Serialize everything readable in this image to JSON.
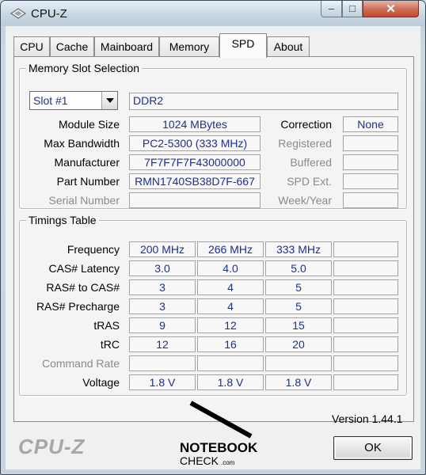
{
  "window": {
    "title": "CPU-Z"
  },
  "tabs": [
    "CPU",
    "Cache",
    "Mainboard",
    "Memory",
    "SPD",
    "About"
  ],
  "active_tab": "SPD",
  "slot_group": {
    "title": "Memory Slot Selection",
    "slot_selected": "Slot #1",
    "memory_type": "DDR2",
    "labels": {
      "module_size": "Module Size",
      "max_bandwidth": "Max Bandwidth",
      "manufacturer": "Manufacturer",
      "part_number": "Part Number",
      "serial_number": "Serial Number",
      "correction": "Correction",
      "registered": "Registered",
      "buffered": "Buffered",
      "spd_ext": "SPD Ext.",
      "week_year": "Week/Year"
    },
    "values": {
      "module_size": "1024 MBytes",
      "max_bandwidth": "PC2-5300 (333 MHz)",
      "manufacturer": "7F7F7F7F43000000",
      "part_number": "RMN1740SB38D7F-667",
      "correction": "None"
    }
  },
  "timings": {
    "title": "Timings Table",
    "rows": [
      {
        "label": "Frequency",
        "values": [
          "200 MHz",
          "266 MHz",
          "333 MHz",
          ""
        ]
      },
      {
        "label": "CAS# Latency",
        "values": [
          "3.0",
          "4.0",
          "5.0",
          ""
        ]
      },
      {
        "label": "RAS# to CAS#",
        "values": [
          "3",
          "4",
          "5",
          ""
        ]
      },
      {
        "label": "RAS# Precharge",
        "values": [
          "3",
          "4",
          "5",
          ""
        ]
      },
      {
        "label": "tRAS",
        "values": [
          "9",
          "12",
          "15",
          ""
        ]
      },
      {
        "label": "tRC",
        "values": [
          "12",
          "16",
          "20",
          ""
        ]
      },
      {
        "label": "Command Rate",
        "values": [
          "",
          "",
          "",
          ""
        ]
      },
      {
        "label": "Voltage",
        "values": [
          "1.8 V",
          "1.8 V",
          "1.8 V",
          ""
        ]
      }
    ]
  },
  "footer": {
    "version": "Version 1.44.1",
    "brand": "CPU-Z",
    "ok_label": "OK"
  },
  "watermark": {
    "line1": "NOTEBOOK",
    "line2": "CHECK",
    "suffix": ".com"
  }
}
